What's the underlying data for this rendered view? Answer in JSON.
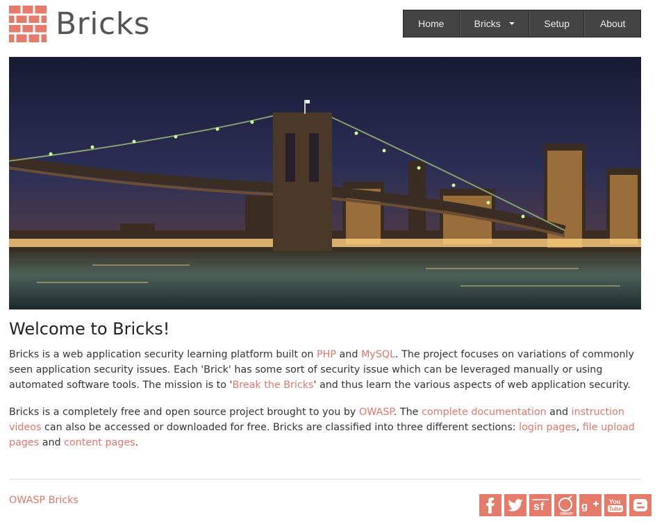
{
  "brand": {
    "name": "Bricks"
  },
  "nav": {
    "home": "Home",
    "bricks": "Bricks",
    "setup": "Setup",
    "about": "About"
  },
  "main": {
    "title": "Welcome to Bricks!",
    "p1": {
      "t1": "Bricks is a web application security learning platform built on ",
      "php": "PHP",
      "t2": " and ",
      "mysql": "MySQL",
      "t3": ". The project focuses on variations of commonly seen application security issues. Each 'Brick' has some sort of security issue which can be leveraged manually or using automated software tools. The mission is to '",
      "break": "Break the Bricks",
      "t4": "' and thus learn the various aspects of web application security."
    },
    "p2": {
      "t1": "Bricks is a completely free and open source project brought to you by ",
      "owasp": "OWASP",
      "t2": ". The ",
      "docs": "complete documentation",
      "t3": " and ",
      "videos": "instruction videos",
      "t4": " can also be accessed or downloaded for free. Bricks are classified into three different sections: ",
      "login": "login pages",
      "t5": ", ",
      "upload": "file upload pages",
      "t6": " and ",
      "content": "content pages",
      "t7": "."
    }
  },
  "footer": {
    "link": "OWASP Bricks",
    "social_icons": [
      "facebook-icon",
      "twitter-icon",
      "sourceforge-icon",
      "owasp-icon",
      "google-plus-icon",
      "youtube-icon",
      "blogger-icon"
    ]
  },
  "colors": {
    "accent": "#e0786a",
    "nav_bg": "#444444"
  }
}
